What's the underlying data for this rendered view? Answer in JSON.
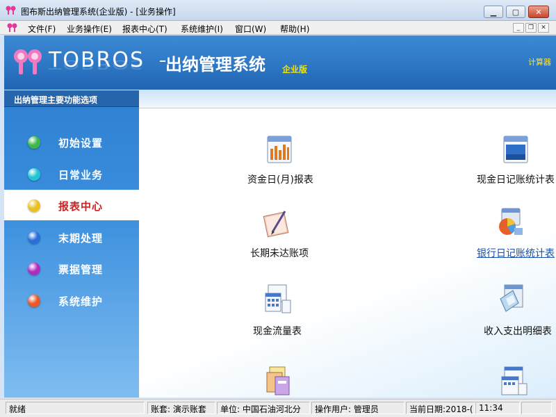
{
  "window": {
    "title": "图布斯出纳管理系统(企业版) - [业务操作]"
  },
  "menu": {
    "items": [
      {
        "label": "文件(F)"
      },
      {
        "label": "业务操作(E)"
      },
      {
        "label": "报表中心(T)"
      },
      {
        "label": "系统维护(I)"
      },
      {
        "label": "窗口(W)"
      },
      {
        "label": "帮助(H)"
      }
    ]
  },
  "banner": {
    "brand": "TOBROS",
    "product": "出纳管理系统",
    "edition": "企业版",
    "calculator": "计算器"
  },
  "sidebar": {
    "header": "出纳管理主要功能选项",
    "items": [
      {
        "label": "初始设置",
        "color": "#3cb84a",
        "active": false
      },
      {
        "label": "日常业务",
        "color": "#22c4d6",
        "active": false
      },
      {
        "label": "报表中心",
        "color": "#e8c020",
        "active": true
      },
      {
        "label": "末期处理",
        "color": "#2a6ed8",
        "active": false
      },
      {
        "label": "票据管理",
        "color": "#b02cc0",
        "active": false
      },
      {
        "label": "系统维护",
        "color": "#e8582a",
        "active": false
      }
    ]
  },
  "functions": [
    {
      "label": "资金日(月)报表",
      "icon": "bar-report-icon"
    },
    {
      "label": "现金日记账统计表",
      "icon": "cash-journal-icon"
    },
    {
      "label": "长期未达账项",
      "icon": "pen-paper-icon"
    },
    {
      "label": "银行日记账统计表",
      "icon": "bank-journal-icon",
      "hover": true
    },
    {
      "label": "现金流量表",
      "icon": "calendar-stack-icon"
    },
    {
      "label": "收入支出明细表",
      "icon": "income-expense-icon"
    },
    {
      "label": "",
      "icon": "document-stack-icon"
    },
    {
      "label": "",
      "icon": "calendar-stack-icon-2"
    }
  ],
  "status": {
    "state": "就绪",
    "account_label": "账套:",
    "account": "演示账套",
    "unit_label": "单位:",
    "unit": "中国石油河北分",
    "user_label": "操作用户:",
    "user": "管理员",
    "date_label": "当前日期:",
    "date": "2018-(",
    "time": "11:34"
  }
}
